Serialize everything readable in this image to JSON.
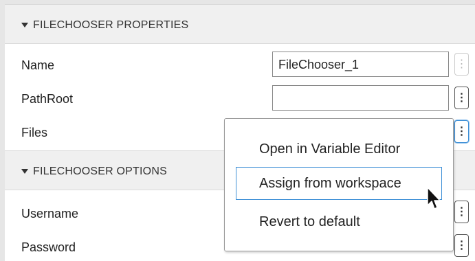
{
  "sections": {
    "properties": {
      "title": "FILECHOOSER PROPERTIES"
    },
    "options": {
      "title": "FILECHOOSER OPTIONS"
    }
  },
  "properties": {
    "name": {
      "label": "Name",
      "value": "FileChooser_1"
    },
    "path_root": {
      "label": "PathRoot",
      "value": ""
    },
    "files": {
      "label": "Files"
    }
  },
  "options": {
    "username": {
      "label": "Username"
    },
    "password": {
      "label": "Password"
    }
  },
  "context_menu": {
    "items": [
      {
        "label": "Open in Variable Editor"
      },
      {
        "label": "Assign from workspace",
        "selected": true
      },
      {
        "label": "Revert to default"
      }
    ]
  },
  "more_button": {
    "glyph": "⋮"
  },
  "colors": {
    "section_header_bg": "#f0f0f0",
    "focus_border": "#3d8fd6",
    "menu_border": "#9a9a9a"
  },
  "icons": {
    "collapse": "triangle-down-icon",
    "more": "vertical-ellipsis-icon",
    "cursor": "mouse-pointer-icon"
  }
}
